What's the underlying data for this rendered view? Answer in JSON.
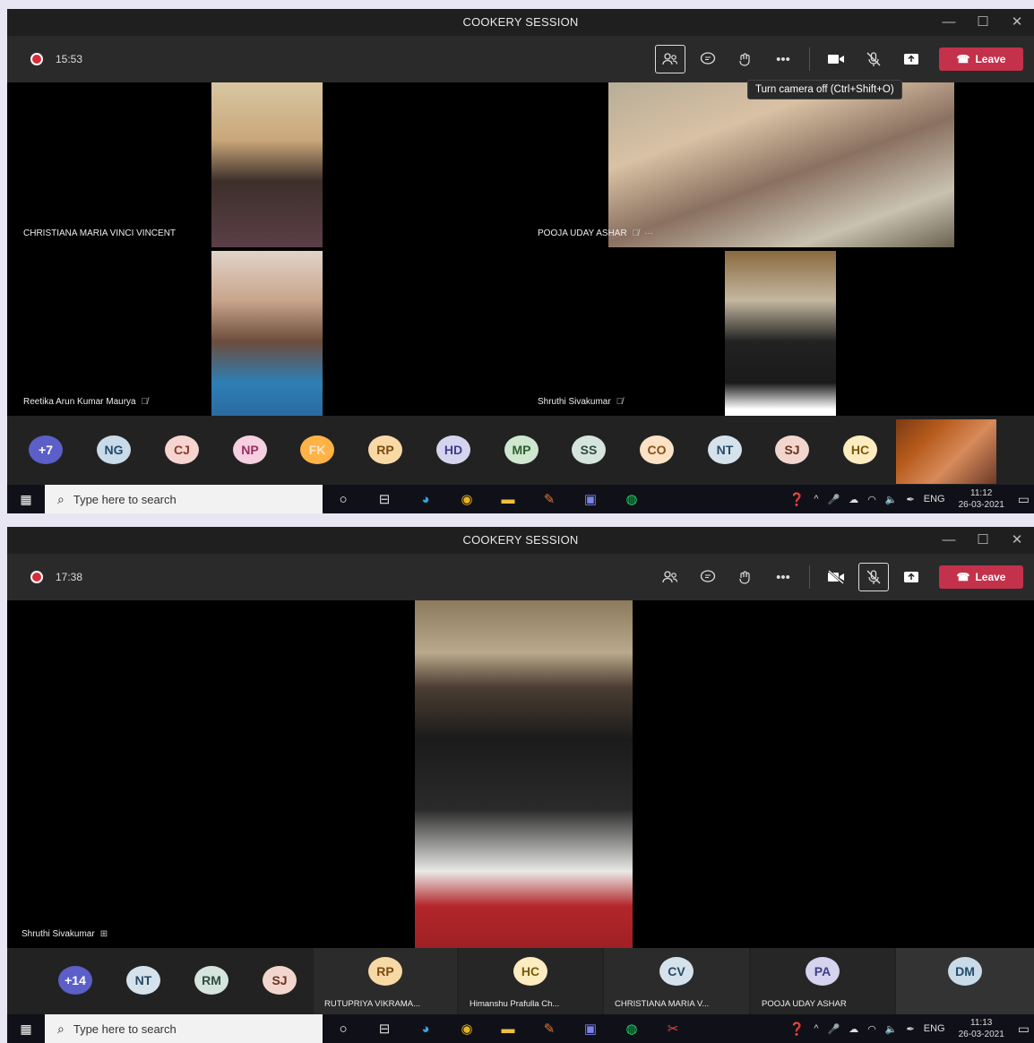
{
  "app": {
    "window_title": "COOKERY SESSION",
    "minimize": "—",
    "maximize": "☐",
    "close": "✕"
  },
  "screen1": {
    "record_time": "15:53",
    "leave_label": "Leave",
    "tooltip": "Turn camera off (Ctrl+Shift+O)",
    "participants": [
      {
        "name": "CHRISTIANA MARIA VINCI VINCENT"
      },
      {
        "name": "POOJA UDAY ASHAR",
        "more": "···"
      },
      {
        "name": "Reetika Arun Kumar Maurya"
      },
      {
        "name": "Shruthi Sivakumar"
      }
    ],
    "avatars": [
      {
        "initials": "+7",
        "bg": "#5b5fc7",
        "fg": "#ffffff"
      },
      {
        "initials": "NG",
        "bg": "#c9dbe8",
        "fg": "#24496b"
      },
      {
        "initials": "CJ",
        "bg": "#f6d5d0",
        "fg": "#8a3a2c"
      },
      {
        "initials": "NP",
        "bg": "#f6cfe1",
        "fg": "#9b2e62"
      },
      {
        "initials": "FK",
        "bg": "#ffb347",
        "fg": "#f5e6c8"
      },
      {
        "initials": "RP",
        "bg": "#f8d9a6",
        "fg": "#7a4b0f"
      },
      {
        "initials": "HD",
        "bg": "#d5d4ee",
        "fg": "#3f3d8a"
      },
      {
        "initials": "MP",
        "bg": "#cfe6cf",
        "fg": "#2d5f2d"
      },
      {
        "initials": "SS",
        "bg": "#d6e4de",
        "fg": "#2e4a40"
      },
      {
        "initials": "CO",
        "bg": "#fbe2c6",
        "fg": "#8a4e13"
      },
      {
        "initials": "NT",
        "bg": "#d5e2ec",
        "fg": "#284a66"
      },
      {
        "initials": "SJ",
        "bg": "#f2d6cd",
        "fg": "#6b3220"
      },
      {
        "initials": "HC",
        "bg": "#fdecc0",
        "fg": "#7a5a08"
      }
    ],
    "taskbar": {
      "search_placeholder": "Type here to search",
      "lang": "ENG",
      "time": "11:12",
      "date": "26-03-2021"
    }
  },
  "screen2": {
    "record_time": "17:38",
    "leave_label": "Leave",
    "main_participant": "Shruthi Sivakumar",
    "avatars": [
      {
        "initials": "+14",
        "bg": "#5b5fc7",
        "fg": "#ffffff"
      },
      {
        "initials": "NT",
        "bg": "#d5e2ec",
        "fg": "#284a66"
      },
      {
        "initials": "RM",
        "bg": "#d6e4de",
        "fg": "#2e4a40"
      },
      {
        "initials": "SJ",
        "bg": "#f2d6cd",
        "fg": "#6b3220"
      }
    ],
    "strip": [
      {
        "initials": "RP",
        "bg": "#f8d9a6",
        "fg": "#7a4b0f",
        "label": "RUTUPRIYA VIKRAMA..."
      },
      {
        "initials": "HC",
        "bg": "#fdecc0",
        "fg": "#7a5a08",
        "label": "Himanshu Prafulla Ch..."
      },
      {
        "initials": "CV",
        "bg": "#d5e2ec",
        "fg": "#284a66",
        "label": "CHRISTIANA MARIA V..."
      },
      {
        "initials": "PA",
        "bg": "#d5d4ee",
        "fg": "#3f3d8a",
        "label": "POOJA UDAY ASHAR"
      },
      {
        "initials": "DM",
        "bg": "#c9dbe8",
        "fg": "#24496b",
        "label": ""
      }
    ],
    "taskbar": {
      "search_placeholder": "Type here to search",
      "lang": "ENG",
      "time": "11:13",
      "date": "26-03-2021"
    }
  },
  "icons": {
    "record": "record-dot-icon",
    "people": "people-icon",
    "chat": "chat-icon",
    "reactions": "reactions-icon",
    "more": "more-icon",
    "camera": "camera-icon",
    "mic": "mic-off-icon",
    "share": "share-icon"
  },
  "colors": {
    "leave": "#c4314b",
    "accent": "#5b5fc7",
    "record": "#d62d3b"
  }
}
